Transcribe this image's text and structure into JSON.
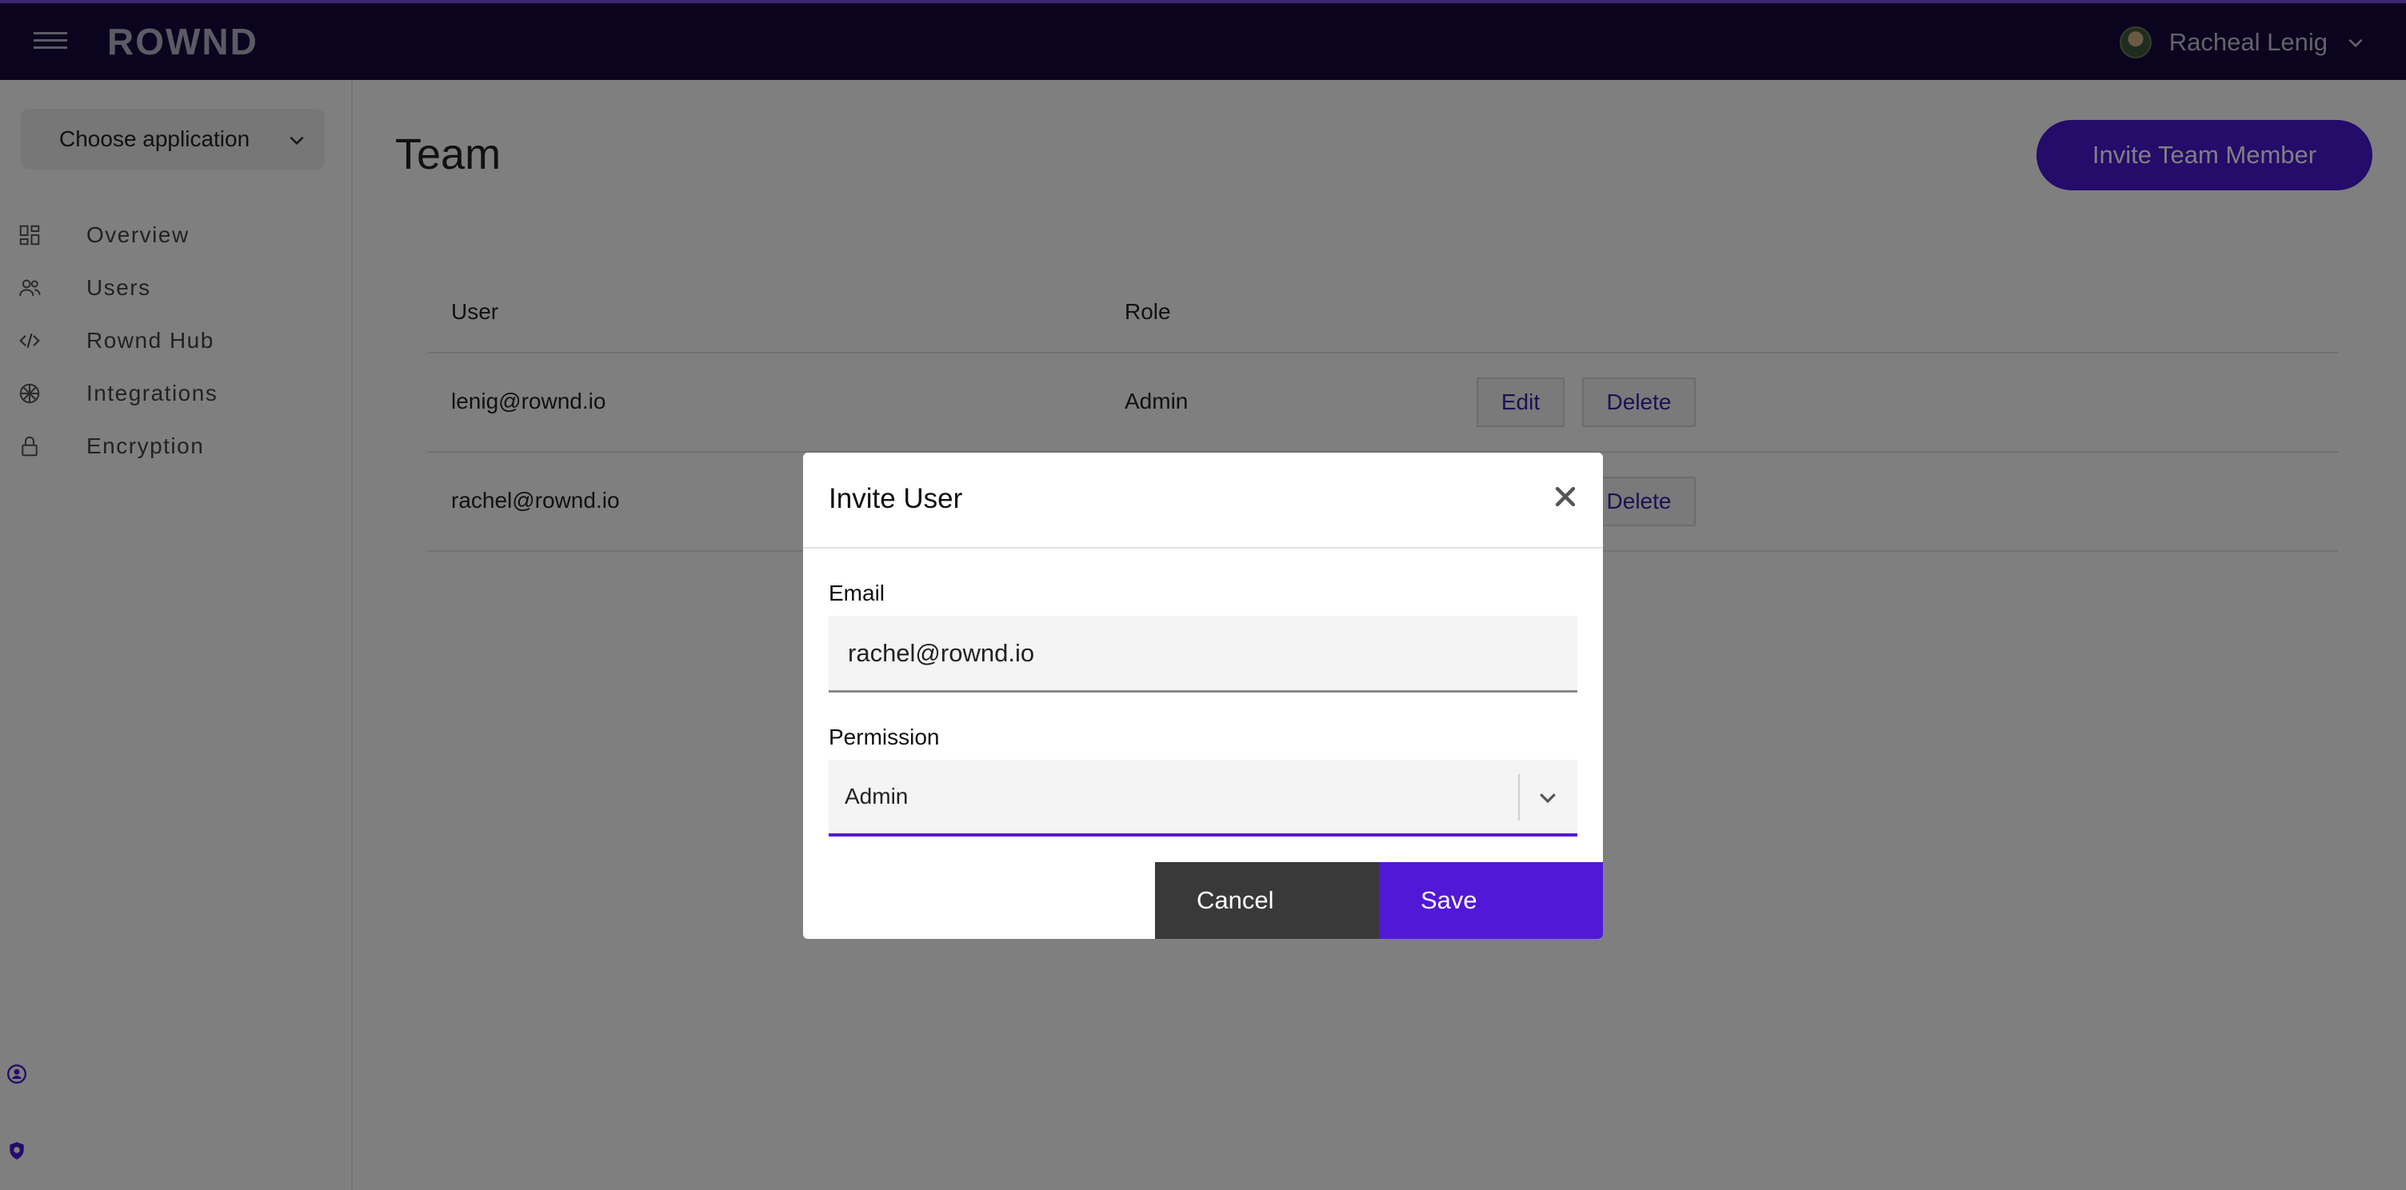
{
  "topbar": {
    "logo": "ROWND",
    "user_name": "Racheal Lenig",
    "menu_icon": "hamburger-icon",
    "chevron_icon": "chevron-down-icon"
  },
  "sidebar": {
    "app_select_label": "Choose application",
    "items": [
      {
        "label": "Overview",
        "icon": "dashboard-icon"
      },
      {
        "label": "Users",
        "icon": "users-icon"
      },
      {
        "label": "Rownd Hub",
        "icon": "code-icon"
      },
      {
        "label": "Integrations",
        "icon": "integrations-icon"
      },
      {
        "label": "Encryption",
        "icon": "lock-icon"
      }
    ]
  },
  "main": {
    "title": "Team",
    "invite_button": "Invite Team Member",
    "table": {
      "headers": [
        "User",
        "Role"
      ],
      "rows": [
        {
          "user": "lenig@rownd.io",
          "role": "Admin",
          "edit": "Edit",
          "delete": "Delete"
        },
        {
          "user": "rachel@rownd.io",
          "role": "",
          "edit": "",
          "delete": "Delete"
        }
      ]
    }
  },
  "modal": {
    "title": "Invite User",
    "email_label": "Email",
    "email_value": "rachel@rownd.io",
    "permission_label": "Permission",
    "permission_value": "Admin",
    "cancel_label": "Cancel",
    "save_label": "Save"
  },
  "colors": {
    "topbar_bg": "#16093f",
    "accent": "#5218d8",
    "cancel_bg": "#393939"
  }
}
